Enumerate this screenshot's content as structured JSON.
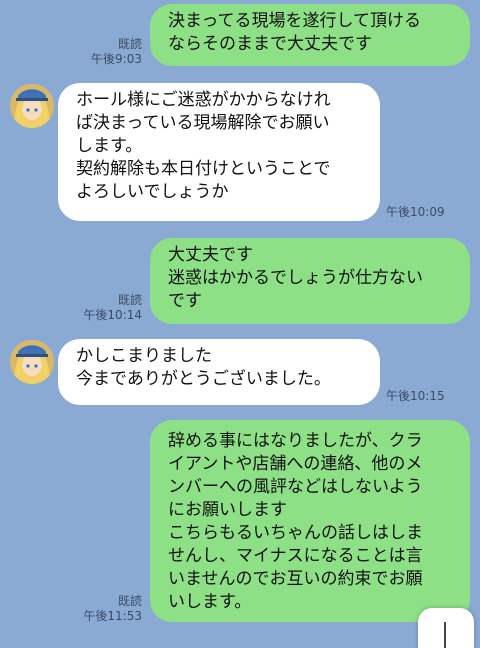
{
  "messages": [
    {
      "direction": "out",
      "lines": [
        "決まってる現場を遂行して頂ける",
        "ならそのままで大丈夫です"
      ],
      "read": "既読",
      "time": "午後9:03"
    },
    {
      "direction": "in",
      "lines": [
        "ホール様にご迷惑がかからなけれ",
        "ば決まっている現場解除でお願い",
        "します。",
        "契約解除も本日付けということで",
        "よろしいでしょうか"
      ],
      "time": "午後10:09"
    },
    {
      "direction": "out",
      "lines": [
        "大丈夫です",
        "迷惑はかかるでしょうが仕方ない",
        "です"
      ],
      "read": "既読",
      "time": "午後10:14"
    },
    {
      "direction": "in",
      "lines": [
        "かしこまりました",
        "今までありがとうございました。"
      ],
      "time": "午後10:15"
    },
    {
      "direction": "out",
      "lines": [
        "辞める事にはなりましたが、クラ",
        "イアントや店舗への連絡、他のメ",
        "ンバーへの風評などはしないよう",
        "にお願いします",
        "こちらもるいちゃんの話しはしま",
        "せんし、マイナスになることは言",
        "いませんのでお互いの約束でお願",
        "いします。"
      ],
      "read": "既読",
      "time": "午後11:53"
    }
  ],
  "colors": {
    "background": "#8aa9d3",
    "outgoing_bubble": "#8de085",
    "incoming_bubble": "#ffffff"
  },
  "icons": {
    "avatar": "contact-avatar",
    "scroll": "scroll-down-icon"
  }
}
